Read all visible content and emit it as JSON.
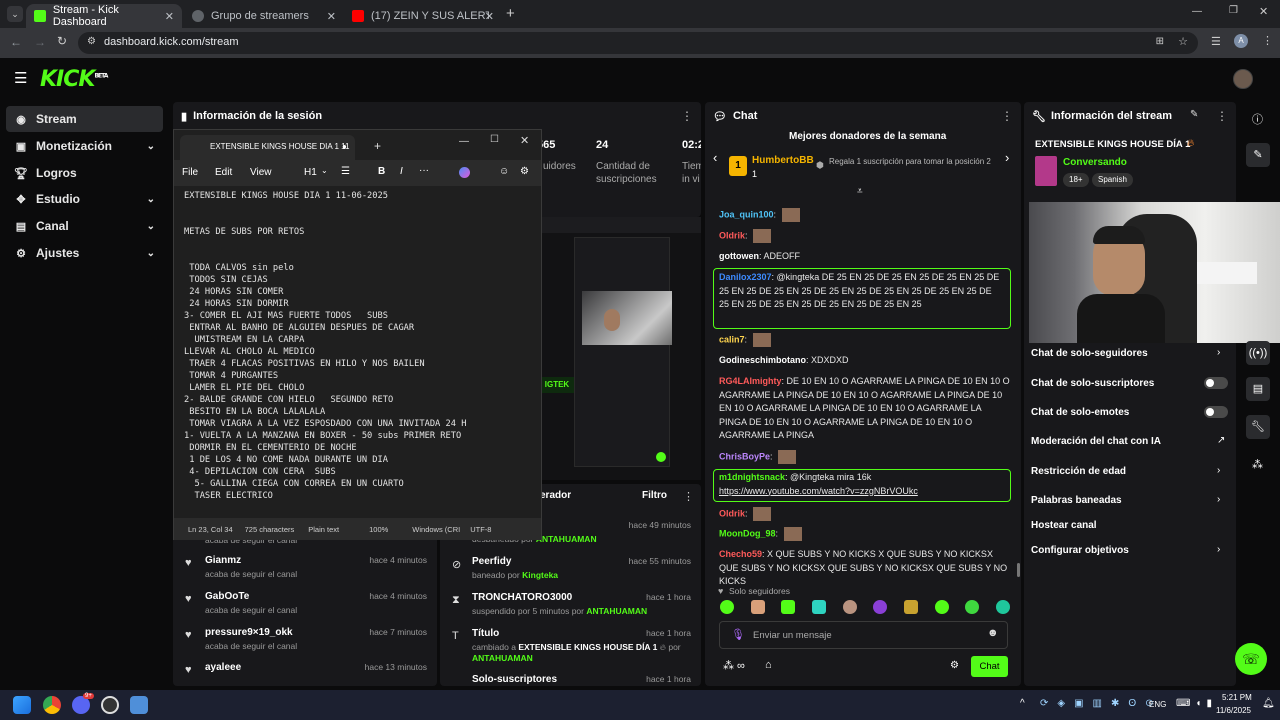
{
  "browser": {
    "tabs": [
      {
        "title": "Stream - Kick Dashboard"
      },
      {
        "title": "Grupo de streamers"
      },
      {
        "title": "(17) ZEIN Y SUS ALERTAS PARA"
      }
    ],
    "url": "dashboard.kick.com/stream"
  },
  "sidebar": {
    "items": [
      {
        "label": "Stream"
      },
      {
        "label": "Monetización"
      },
      {
        "label": "Logros"
      },
      {
        "label": "Estudio"
      },
      {
        "label": "Canal"
      },
      {
        "label": "Ajustes"
      }
    ]
  },
  "session": {
    "title": "Información de la sesión",
    "stat1_value": "565",
    "stat1_label": "uidores",
    "stat2_value": "24",
    "stat2_label_1": "Cantidad de",
    "stat2_label_2": "suscripciones",
    "stat3_value": "02:2",
    "stat3_label_1": "Tiem",
    "stat3_label_2": "in vi"
  },
  "notepad": {
    "tab_title": "EXTENSIBLE KINGS HOUSE DIA 1 11",
    "menu": {
      "file": "File",
      "edit": "Edit",
      "view": "View",
      "heading": "H1"
    },
    "lines": [
      "EXTENSIBLE KINGS HOUSE DIA 1 11-06-2025",
      "",
      "",
      "METAS DE SUBS POR RETOS",
      "",
      "",
      " TODA CALVOS sin pelo",
      " TODOS SIN CEJAS",
      " 24 HORAS SIN COMER",
      " 24 HORAS SIN DORMIR",
      "3- COMER EL AJI MAS FUERTE TODOS   SUBS",
      " ENTRAR AL BANHO DE ALGUIEN DESPUES DE CAGAR",
      "  UMISTREAM EN LA CARPA",
      "LLEVAR AL CHOLO AL MEDICO",
      " TRAER 4 FLACAS POSITIVAS EN HILO Y NOS BAILEN",
      " TOMAR 4 PURGANTES",
      " LAMER EL PIE DEL CHOLO",
      "2- BALDE GRANDE CON HIELO   SEGUNDO RETO",
      " BESITO EN LA BOCA LALALALA",
      " TOMAR VIAGRA A LA VEZ ESPOSDADO CON UNA INVITADA 24 H",
      "1- VUELTA A LA MANZANA EN BOXER - 50 subs PRIMER RETO",
      " DORMIR EN EL CEMENTERIO DE NOCHE",
      " 1 DE LOS 4 NO COME NADA DURANTE UN DIA",
      " 4- DEPILACION CON CERA  SUBS",
      "  5- GALLINA CIEGA CON CORREA EN UN CUARTO",
      "  TASER ELECTRICO"
    ],
    "status": {
      "pos": "Ln 23, Col 34",
      "chars": "725 characters",
      "fmt": "Plain text",
      "zoom": "100%",
      "eol": "Windows (CRI",
      "enc": "UTF-8"
    }
  },
  "activity_left": {
    "items": [
      {
        "name": "",
        "desc": "acaba de seguir el canal",
        "time": ""
      },
      {
        "name": "Gianmz",
        "desc": "acaba de seguir el canal",
        "time": "hace 4 minutos"
      },
      {
        "name": "GabOoTe",
        "desc": "acaba de seguir el canal",
        "time": "hace 4 minutos"
      },
      {
        "name": "pressure9×19_okk",
        "desc": "acaba de seguir el canal",
        "time": "hace 7 minutos"
      },
      {
        "name": "ayaleee",
        "desc": "",
        "time": "hace 13 minutos"
      }
    ]
  },
  "moderator": {
    "title": "erador",
    "filter": "Filtro",
    "items": [
      {
        "name": "",
        "desc_pre": "desbaneado por",
        "desc_by": "ANTAHUAMAN",
        "time": "hace 49 minutos"
      },
      {
        "name": "Peerfidy",
        "desc_pre": "baneado por",
        "desc_by": "Kingteka",
        "time": "hace 55 minutos"
      },
      {
        "name": "TRONCHATORO3000",
        "desc_pre": "suspendido por 5 minutos por",
        "desc_by": "ANTAHUAMAN",
        "time": "hace 1 hora"
      },
      {
        "name": "Título",
        "desc_pre": "cambiado a",
        "desc_by": "EXTENSIBLE KINGS HOUSE DÍA 1",
        "desc_post": "por",
        "desc_by2": "ANTAHUAMAN",
        "time": "hace 1 hora"
      },
      {
        "name": "Solo-suscriptores",
        "time": "hace 1 hora"
      }
    ]
  },
  "chat": {
    "title": "Chat",
    "donors_title": "Mejores donadores de la semana",
    "donor_name": "HumbertoBB",
    "donor_count": "1",
    "donor_rank": "1",
    "gift_text": "Regala 1 suscripción para tomar la posición 2",
    "messages": [
      {
        "user": "Joa_quin100",
        "text": ""
      },
      {
        "user": "Oldrik",
        "text": ""
      },
      {
        "user": "gottowen",
        "text": "ADEOFF"
      },
      {
        "user": "Danilox2307",
        "text": "@kingteka DE 25 EN 25 DE 25 EN 25 DE 25 EN 25 DE 25 EN 25 DE 25 EN 25 DE 25 EN 25 DE 25 EN 25 DE 25 EN 25 DE 25 EN 25 DE 25 EN 25 DE 25 EN 25 DE 25 EN 25"
      },
      {
        "user": "calin7",
        "text": ""
      },
      {
        "user": "Godineschimbotano",
        "text": "XDXDXD"
      },
      {
        "user": "RG4LAImighty",
        "text": "DE 10 EN 10 O AGARRAME LA PINGA DE 10 EN 10 O AGARRAME LA PINGA DE 10 EN 10 O AGARRAME LA PINGA DE 10 EN 10 O AGARRAME LA PINGA DE 10 EN 10 O AGARRAME LA PINGA DE 10 EN 10 O AGARRAME LA PINGA DE 10 EN 10 O AGARRAME LA PINGA"
      },
      {
        "user": "ChrisBoyPe",
        "text": ""
      },
      {
        "user": "m1dnightsnack",
        "text": "@Kingteka mira 16k",
        "link": "https://www.youtube.com/watch?v=zzgNBrVOUkc"
      },
      {
        "user": "Oldrik",
        "text": ""
      },
      {
        "user": "MoonDog_98",
        "text": ""
      },
      {
        "user": "Checho59",
        "text": "X QUE SUBS Y NO KICKS X QUE SUBS Y NO KICKSX QUE SUBS Y NO KICKSX QUE SUBS Y NO KICKSX QUE SUBS Y NO KICKS"
      }
    ],
    "mode": "Solo seguidores",
    "input_placeholder": "Enviar un mensaje",
    "send": "Chat"
  },
  "stream_info": {
    "title": "Información del stream",
    "stream_title": "EXTENSIBLE KINGS HOUSE DÍA 1",
    "category": "Conversando",
    "tag1": "18+",
    "tag2": "Spanish",
    "options": [
      {
        "label": "Chat de solo-seguidores"
      },
      {
        "label": "Chat de solo-suscriptores"
      },
      {
        "label": "Chat de solo-emotes"
      },
      {
        "label": "Moderación del chat con IA"
      },
      {
        "label": "Restricción de edad"
      },
      {
        "label": "Palabras baneadas"
      },
      {
        "label": "Hostear canal"
      },
      {
        "label": "Configurar objetivos"
      }
    ]
  },
  "taskbar": {
    "lang": "ENG",
    "time": "5:21 PM",
    "date": "11/6/2025",
    "badge": "9+"
  },
  "colors": {
    "accent": "#53fc18",
    "panel": "#18181b",
    "bg": "#0b0b0c"
  }
}
